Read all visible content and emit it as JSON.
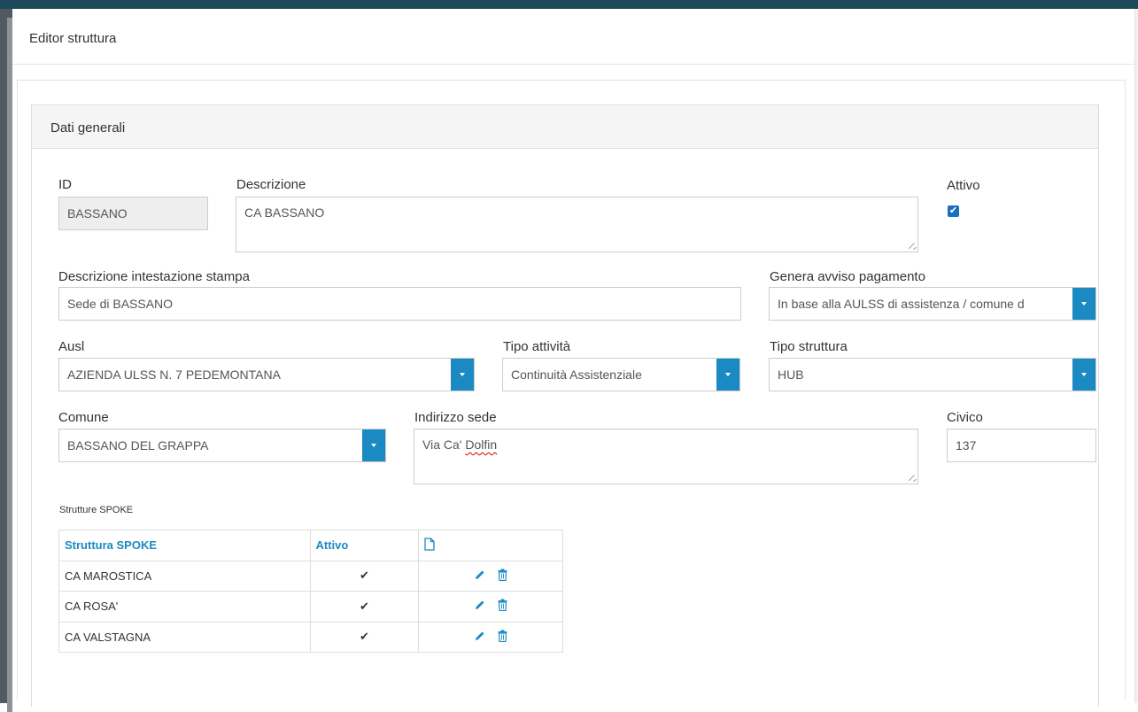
{
  "modal": {
    "title": "Editor struttura"
  },
  "panel": {
    "heading": "Dati generali"
  },
  "form": {
    "id": {
      "label": "ID",
      "value": "BASSANO"
    },
    "descrizione": {
      "label": "Descrizione",
      "value": "CA BASSANO"
    },
    "attivo": {
      "label": "Attivo",
      "checked": true,
      "check_glyph": "✔"
    },
    "intestazione": {
      "label": "Descrizione intestazione stampa",
      "value": "Sede di BASSANO"
    },
    "avviso": {
      "label": "Genera avviso pagamento",
      "value": "In base alla AULSS di assistenza / comune d"
    },
    "ausl": {
      "label": "Ausl",
      "value": "AZIENDA ULSS N. 7 PEDEMONTANA"
    },
    "tipo_attivita": {
      "label": "Tipo attività",
      "value": "Continuità Assistenziale"
    },
    "tipo_struttura": {
      "label": "Tipo struttura",
      "value": "HUB"
    },
    "comune": {
      "label": "Comune",
      "value": "BASSANO DEL GRAPPA"
    },
    "indirizzo": {
      "label": "Indirizzo sede",
      "value_prefix": "Via Ca' ",
      "value_misspelled": "Dolfin"
    },
    "civico": {
      "label": "Civico",
      "value": "137"
    }
  },
  "spoke": {
    "section_label": "Strutture SPOKE",
    "headers": {
      "struttura": "Struttura SPOKE",
      "attivo": "Attivo",
      "new_icon": "file-new-icon"
    },
    "rows": [
      {
        "name": "CA MAROSTICA",
        "attivo": "✔"
      },
      {
        "name": "CA ROSA'",
        "attivo": "✔"
      },
      {
        "name": "CA VALSTAGNA",
        "attivo": "✔"
      }
    ],
    "row_icons": {
      "edit": "pencil-icon",
      "delete": "trash-icon"
    }
  },
  "colors": {
    "accent": "#1b8ac2",
    "checkbox": "#1b6fc0",
    "topbar": "#1d4a5a"
  }
}
